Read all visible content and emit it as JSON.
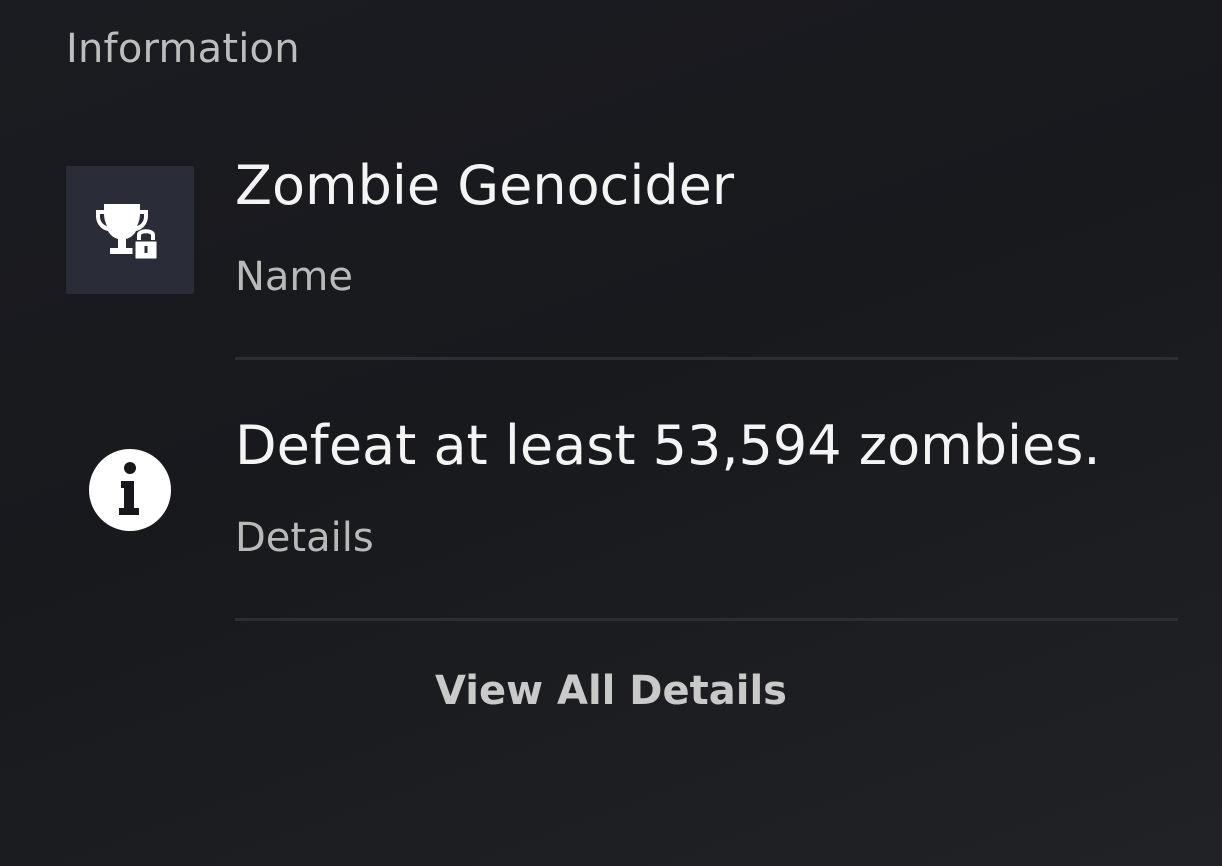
{
  "section": {
    "title": "Information"
  },
  "trophy": {
    "icon": "trophy-locked-icon",
    "name": "Zombie Genocider",
    "name_label": "Name"
  },
  "details": {
    "icon": "info-icon",
    "text": "Defeat at least 53,594 zombies.",
    "label": "Details"
  },
  "actions": {
    "view_all_label": "View All Details"
  },
  "colors": {
    "background": "#1b1c21",
    "icon_tile": "#2a2d37",
    "primary_text": "#f4f4f4",
    "secondary_text": "#b9b9b9",
    "divider": "#2c2e33"
  }
}
